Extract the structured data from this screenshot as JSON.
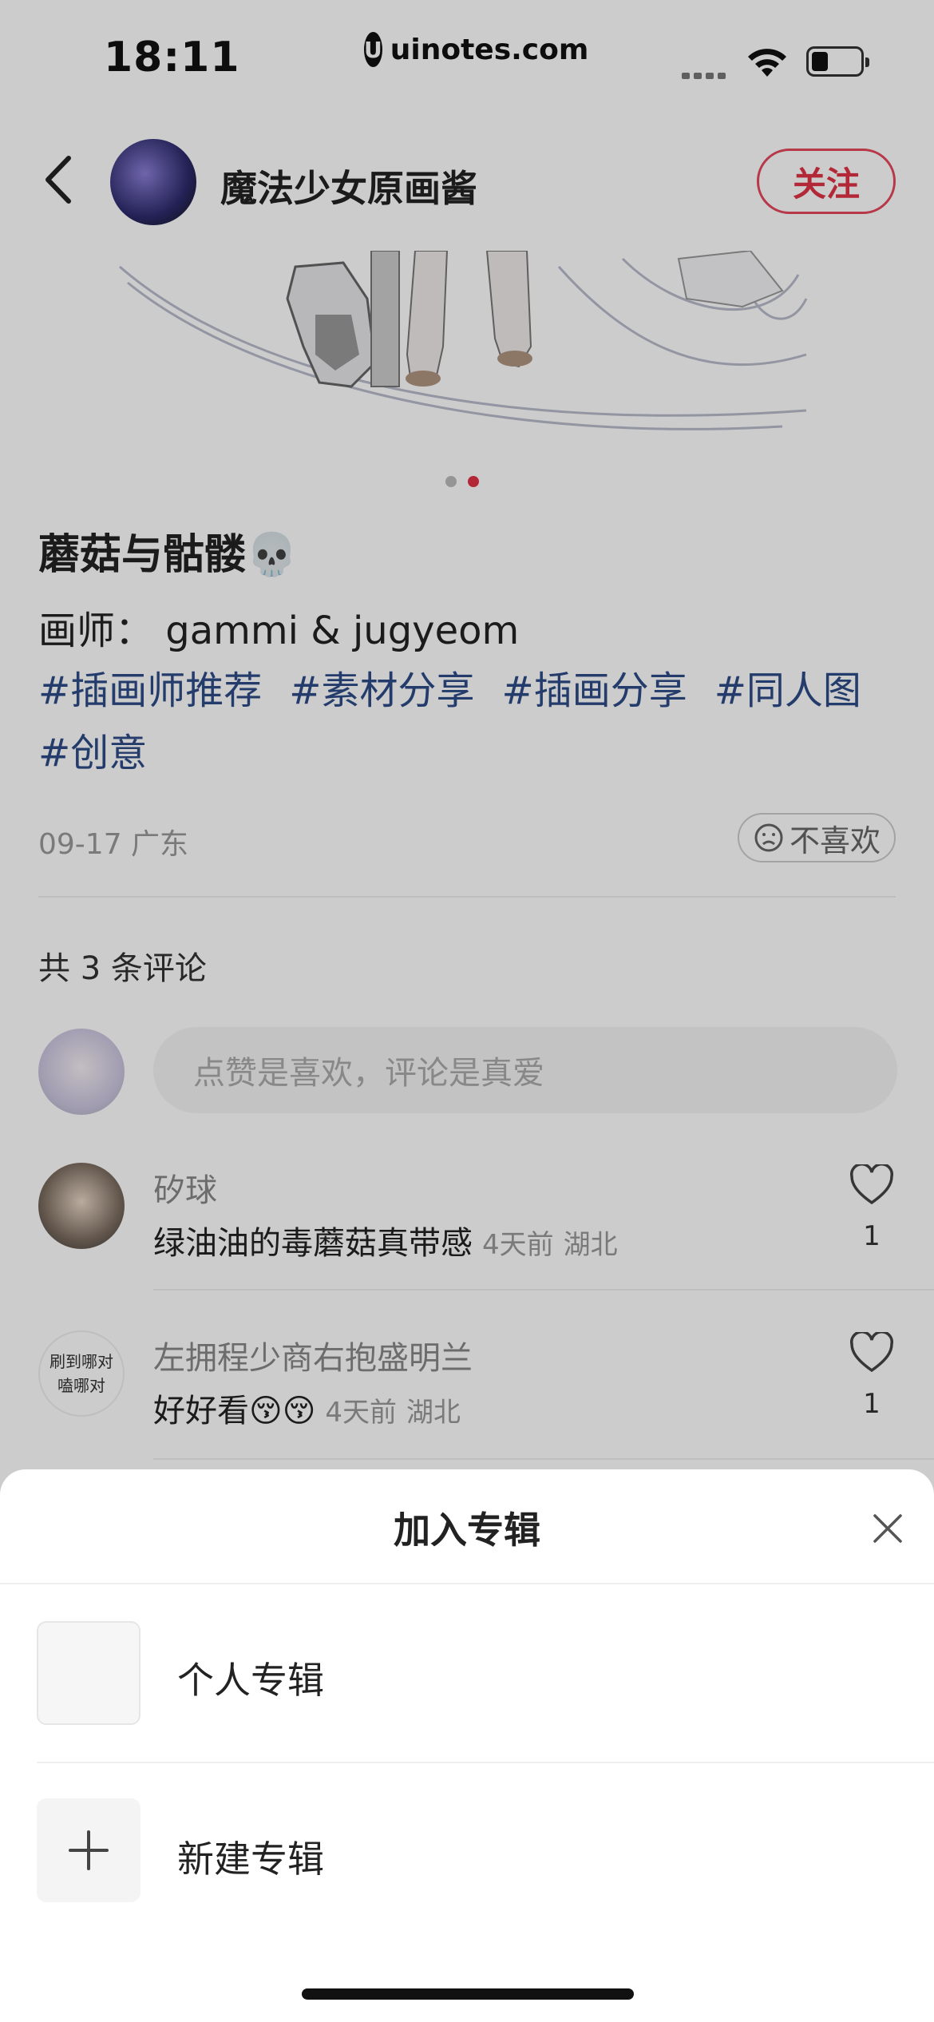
{
  "status_bar": {
    "time": "18:11",
    "url": "uinotes.com"
  },
  "header": {
    "author": "魔法少女原画酱",
    "follow_label": "关注"
  },
  "post": {
    "title": "蘑菇与骷髅💀",
    "body": "画师： gammi & jugyeom",
    "tags": [
      "#插画师推荐",
      "#素材分享",
      "#插画分享",
      "#同人图",
      "#创意"
    ],
    "meta": "09-17 广东",
    "dislike_label": "不喜欢",
    "image_pages": 2,
    "active_image_page": 2
  },
  "comments": {
    "count_label": "共 3 条评论",
    "input_placeholder": "点赞是喜欢，评论是真爱",
    "items": [
      {
        "user": "矽球",
        "text": "绿油油的毒蘑菇真带感",
        "time": "4天前",
        "location": "湖北",
        "likes": "1"
      },
      {
        "user": "左拥程少商右抱盛明兰",
        "avatar_text": "刷到哪对嗑哪对",
        "text": "好好看😚😚",
        "time": "4天前",
        "location": "湖北",
        "likes": "1"
      }
    ]
  },
  "sheet": {
    "title": "加入专辑",
    "albums": [
      {
        "label": "个人专辑"
      }
    ],
    "new_album_label": "新建专辑"
  }
}
